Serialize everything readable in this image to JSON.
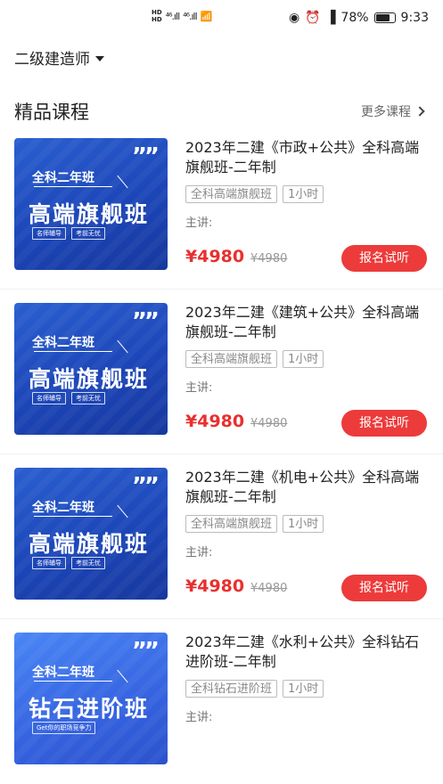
{
  "status_bar": {
    "hd1": "HD",
    "hd2": "HD",
    "signal1": "⁴⁶.ıll",
    "signal2": "⁴⁶.ıll",
    "battery_text": "78%",
    "time": "9:33"
  },
  "header": {
    "selector_label": "二级建造师"
  },
  "section": {
    "title": "精品课程",
    "more_label": "更多课程"
  },
  "courses": [
    {
      "thumb_tag": "全科二年班",
      "thumb_big": "高端旗舰班",
      "thumb_chip1": "名师辅导",
      "thumb_chip2": "考前无忧",
      "title": "2023年二建《市政+公共》全科高端旗舰班-二年制",
      "tag1": "全科高端旗舰班",
      "tag2": "1小时",
      "lecturer": "主讲:",
      "price": "¥4980",
      "old_price": "¥4980",
      "button": "报名试听"
    },
    {
      "thumb_tag": "全科二年班",
      "thumb_big": "高端旗舰班",
      "thumb_chip1": "名师辅导",
      "thumb_chip2": "考前无忧",
      "title": "2023年二建《建筑+公共》全科高端旗舰班-二年制",
      "tag1": "全科高端旗舰班",
      "tag2": "1小时",
      "lecturer": "主讲:",
      "price": "¥4980",
      "old_price": "¥4980",
      "button": "报名试听"
    },
    {
      "thumb_tag": "全科二年班",
      "thumb_big": "高端旗舰班",
      "thumb_chip1": "名师辅导",
      "thumb_chip2": "考前无忧",
      "title": "2023年二建《机电+公共》全科高端旗舰班-二年制",
      "tag1": "全科高端旗舰班",
      "tag2": "1小时",
      "lecturer": "主讲:",
      "price": "¥4980",
      "old_price": "¥4980",
      "button": "报名试听"
    },
    {
      "thumb_tag": "全科二年班",
      "thumb_big": "钻石进阶班",
      "thumb_chip1": "Get你的职场竞争力",
      "title": "2023年二建《水利+公共》全科钻石进阶班-二年制",
      "tag1": "全科钻石进阶班",
      "tag2": "1小时",
      "lecturer": "主讲:"
    }
  ],
  "colors": {
    "accent": "#ec3b3a",
    "price": "#e8302f",
    "thumb_blue": "#1c46b8"
  }
}
